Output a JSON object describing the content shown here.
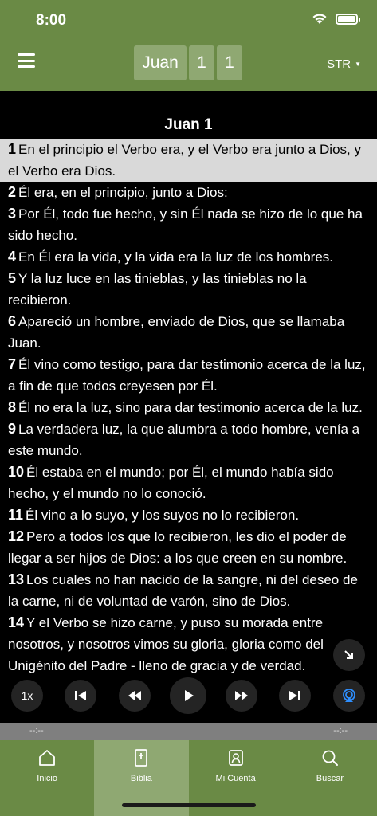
{
  "status": {
    "time": "8:00"
  },
  "header": {
    "book": "Juan",
    "chapter": "1",
    "verse": "1",
    "version": "STR"
  },
  "chapter_title": "Juan 1",
  "verses": [
    {
      "n": "1",
      "text": "En el principio el Verbo era, y el Verbo era junto a Dios, y el Verbo era Dios."
    },
    {
      "n": "2",
      "text": "Él era, en el principio, junto a Dios:"
    },
    {
      "n": "3",
      "text": "Por Él, todo fue hecho, y sin Él nada se hizo de lo que ha sido hecho."
    },
    {
      "n": "4",
      "text": "En Él era la vida, y la vida era la luz de los hombres."
    },
    {
      "n": "5",
      "text": "Y la luz luce en las tinieblas, y las tinieblas no la recibieron."
    },
    {
      "n": "6",
      "text": "Apareció un hombre, enviado de Dios, que se llamaba Juan."
    },
    {
      "n": "7",
      "text": "Él vino como testigo, para dar testimonio acerca de la luz, a fin de que todos creyesen por Él."
    },
    {
      "n": "8",
      "text": "Él no era la luz, sino para dar testimonio acerca de la luz."
    },
    {
      "n": "9",
      "text": "La verdadera luz, la que alumbra a todo hombre, venía a este mundo."
    },
    {
      "n": "10",
      "text": "Él estaba en el mundo; por Él, el mundo había sido hecho, y el mundo no lo conoció."
    },
    {
      "n": "11",
      "text": "Él vino a lo suyo, y los suyos no lo recibieron."
    },
    {
      "n": "12",
      "text": "Pero a todos los que lo recibieron, les dio el poder de llegar a ser hijos de Dios: a los que creen en su nombre."
    },
    {
      "n": "13",
      "text": "Los cuales no han nacido de la sangre, ni del deseo de la carne, ni de voluntad de varón, sino de Dios."
    },
    {
      "n": "14",
      "text": "Y el Verbo se hizo carne, y puso su morada entre nosotros, y nosotros vimos su gloria, gloria como del Unigénito del Padre - lleno de gracia y de verdad."
    }
  ],
  "player": {
    "speed": "1x"
  },
  "scrubber": {
    "elapsed": "--:--",
    "remaining": "--:--"
  },
  "tabs": [
    {
      "label": "Inicio",
      "icon": "home-icon"
    },
    {
      "label": "Biblia",
      "icon": "bible-icon"
    },
    {
      "label": "Mi Cuenta",
      "icon": "account-icon"
    },
    {
      "label": "Buscar",
      "icon": "search-icon"
    }
  ],
  "colors": {
    "header": "#6a8a45",
    "active_tab": "#8fa872",
    "selected_verse": "#d9d9d9"
  }
}
